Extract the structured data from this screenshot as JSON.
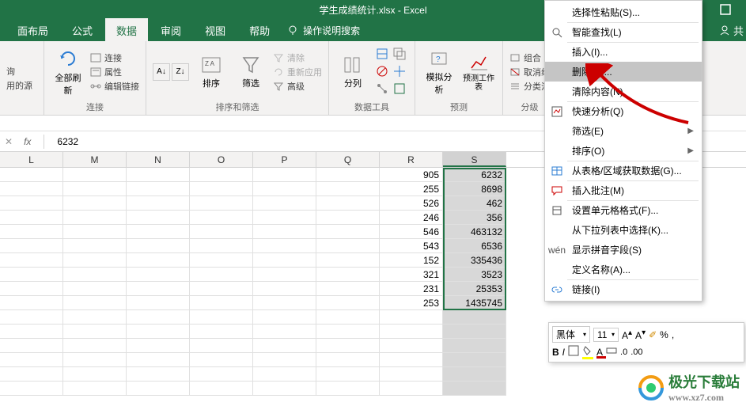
{
  "title": "学生成绩统计.xlsx  -  Excel",
  "right_btn": "共",
  "tabs": [
    "面布局",
    "公式",
    "数据",
    "审阅",
    "视图",
    "帮助"
  ],
  "active_tab": "数据",
  "tell_me": "操作说明搜索",
  "ribbon": {
    "g1": {
      "items": [
        "询",
        "用的源"
      ]
    },
    "g2": {
      "label": "连接",
      "big": "全部刷新",
      "items": [
        "连接",
        "属性",
        "编辑链接"
      ]
    },
    "g3": {
      "label": "排序和筛选",
      "big1": "排序",
      "big2": "筛选",
      "items": [
        "清除",
        "重新应用",
        "高级"
      ]
    },
    "g4": {
      "label": "数据工具",
      "big": "分列"
    },
    "g5": {
      "label": "预测",
      "big1": "模拟分析",
      "big2": "预测工作表"
    },
    "g6": {
      "label": "分级",
      "items": [
        "组合",
        "取消组",
        "分类汇"
      ]
    }
  },
  "formula_value": "6232",
  "columns": [
    "L",
    "M",
    "N",
    "O",
    "P",
    "Q",
    "R",
    "S"
  ],
  "sel_col_index": 7,
  "rows": [
    {
      "R": "905",
      "S": "6232"
    },
    {
      "R": "255",
      "S": "8698"
    },
    {
      "R": "526",
      "S": "462"
    },
    {
      "R": "246",
      "S": "356"
    },
    {
      "R": "546",
      "S": "463132"
    },
    {
      "R": "543",
      "S": "6536"
    },
    {
      "R": "152",
      "S": "335436"
    },
    {
      "R": "321",
      "S": "3523"
    },
    {
      "R": "231",
      "S": "25353"
    },
    {
      "R": "253",
      "S": "1435745"
    }
  ],
  "empty_rows": 6,
  "context_menu": [
    {
      "id": "paste-special",
      "label": "选择性粘贴(S)...",
      "icon": "",
      "sep": true
    },
    {
      "id": "smart-lookup",
      "label": "智能查找(L)",
      "icon": "search",
      "sep": true
    },
    {
      "id": "insert",
      "label": "插入(I)..."
    },
    {
      "id": "delete",
      "label": "删除(D)...",
      "hover": true
    },
    {
      "id": "clear",
      "label": "清除内容(N)",
      "sep": true
    },
    {
      "id": "quick-analysis",
      "label": "快速分析(Q)",
      "icon": "qa"
    },
    {
      "id": "filter",
      "label": "筛选(E)",
      "arrow": true
    },
    {
      "id": "sort",
      "label": "排序(O)",
      "arrow": true,
      "sep": true
    },
    {
      "id": "get-data",
      "label": "从表格/区域获取数据(G)...",
      "icon": "table",
      "sep": true
    },
    {
      "id": "insert-comment",
      "label": "插入批注(M)",
      "icon": "comment",
      "sep": true
    },
    {
      "id": "format-cells",
      "label": "设置单元格格式(F)...",
      "icon": "format"
    },
    {
      "id": "dropdown",
      "label": "从下拉列表中选择(K)..."
    },
    {
      "id": "pinyin",
      "label": "显示拼音字段(S)",
      "icon": "wen"
    },
    {
      "id": "define-name",
      "label": "定义名称(A)...",
      "sep": true
    },
    {
      "id": "link",
      "label": "链接(I)",
      "icon": "link"
    }
  ],
  "mini_toolbar": {
    "font": "黑体",
    "size": "11",
    "btns": [
      "B",
      "I"
    ]
  },
  "watermark": {
    "main": "极光下载站",
    "sub": "www.xz7.com"
  }
}
